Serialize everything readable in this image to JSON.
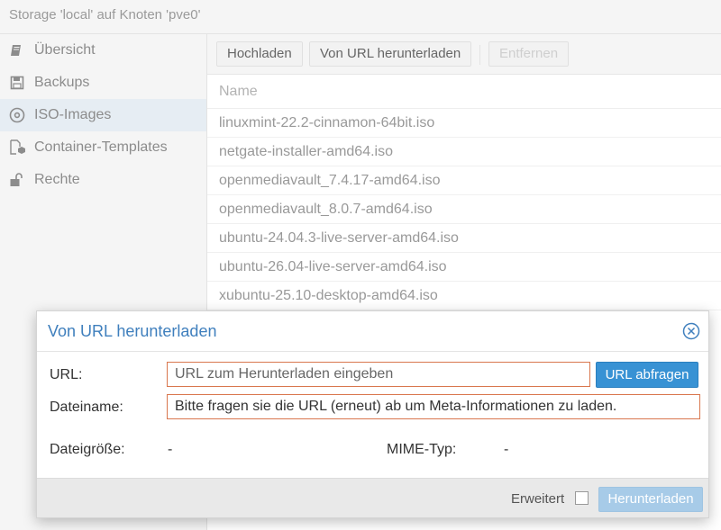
{
  "window": {
    "title": "Storage 'local' auf Knoten 'pve0'"
  },
  "sidebar": {
    "items": [
      {
        "label": "Übersicht",
        "icon": "book-icon",
        "active": false
      },
      {
        "label": "Backups",
        "icon": "floppy-disk-icon",
        "active": false
      },
      {
        "label": "ISO-Images",
        "icon": "disc-icon",
        "active": true
      },
      {
        "label": "Container-Templates",
        "icon": "file-cube-icon",
        "active": false
      },
      {
        "label": "Rechte",
        "icon": "unlock-icon",
        "active": false
      }
    ]
  },
  "toolbar": {
    "upload_label": "Hochladen",
    "download_url_label": "Von URL herunterladen",
    "remove_label": "Entfernen"
  },
  "table": {
    "column_name": "Name",
    "rows": [
      "linuxmint-22.2-cinnamon-64bit.iso",
      "netgate-installer-amd64.iso",
      "openmediavault_7.4.17-amd64.iso",
      "openmediavault_8.0.7-amd64.iso",
      "ubuntu-24.04.3-live-server-amd64.iso",
      "ubuntu-26.04-live-server-amd64.iso",
      "xubuntu-25.10-desktop-amd64.iso"
    ]
  },
  "dialog": {
    "title": "Von URL herunterladen",
    "url_label": "URL:",
    "url_placeholder": "URL zum Herunterladen eingeben",
    "query_button": "URL abfragen",
    "filename_label": "Dateiname:",
    "filename_value": "Bitte fragen sie die URL (erneut) ab um Meta-Informationen zu laden.",
    "filesize_label": "Dateigröße:",
    "filesize_value": "-",
    "mime_label": "MIME-Typ:",
    "mime_value": "-",
    "advanced_label": "Erweitert",
    "download_button": "Herunterladen"
  },
  "colors": {
    "accent": "#3892d4",
    "title_blue": "#3f7fbd",
    "invalid_border": "#d9774e",
    "active_nav_bg": "#e6edf3"
  }
}
